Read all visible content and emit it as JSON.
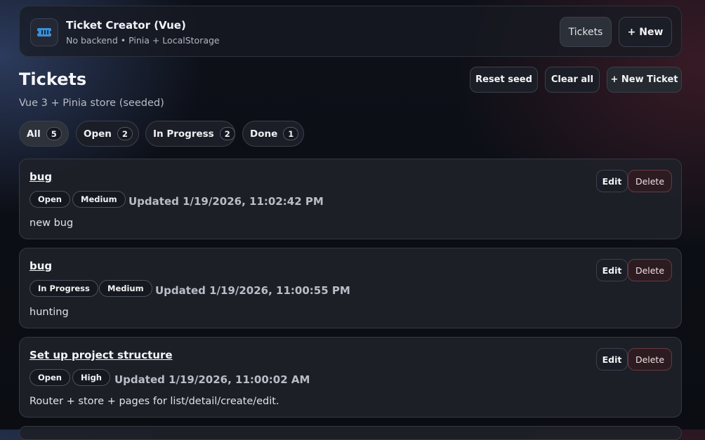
{
  "header": {
    "app_icon": "ticket-icon",
    "title": "Ticket Creator (Vue)",
    "subtitle": "No backend • Pinia + LocalStorage",
    "nav": {
      "tickets_label": "Tickets",
      "new_label": "+ New"
    }
  },
  "page": {
    "title": "Tickets",
    "subtitle": "Vue 3 + Pinia store (seeded)",
    "actions": {
      "reset_label": "Reset seed",
      "clear_label": "Clear all",
      "new_label": "+ New Ticket"
    }
  },
  "filters": [
    {
      "label": "All",
      "count": "5",
      "active": true
    },
    {
      "label": "Open",
      "count": "2",
      "active": false
    },
    {
      "label": "In Progress",
      "count": "2",
      "active": false
    },
    {
      "label": "Done",
      "count": "1",
      "active": false
    }
  ],
  "tickets": [
    {
      "title": "bug",
      "status": "Open",
      "priority": "Medium",
      "updated": "Updated 1/19/2026, 11:02:42 PM",
      "description": "new bug"
    },
    {
      "title": "bug",
      "status": "In Progress",
      "priority": "Medium",
      "updated": "Updated 1/19/2026, 11:00:55 PM",
      "description": "hunting"
    },
    {
      "title": "Set up project structure",
      "status": "Open",
      "priority": "High",
      "updated": "Updated 1/19/2026, 11:00:02 AM",
      "description": "Router + store + pages for list/detail/create/edit."
    }
  ],
  "ticket_actions": {
    "edit_label": "Edit",
    "delete_label": "Delete"
  },
  "colors": {
    "accent": "#2d323b",
    "danger_border": "#6a3941",
    "danger_bg": "#2c1c21",
    "background": "#0b0d13"
  }
}
